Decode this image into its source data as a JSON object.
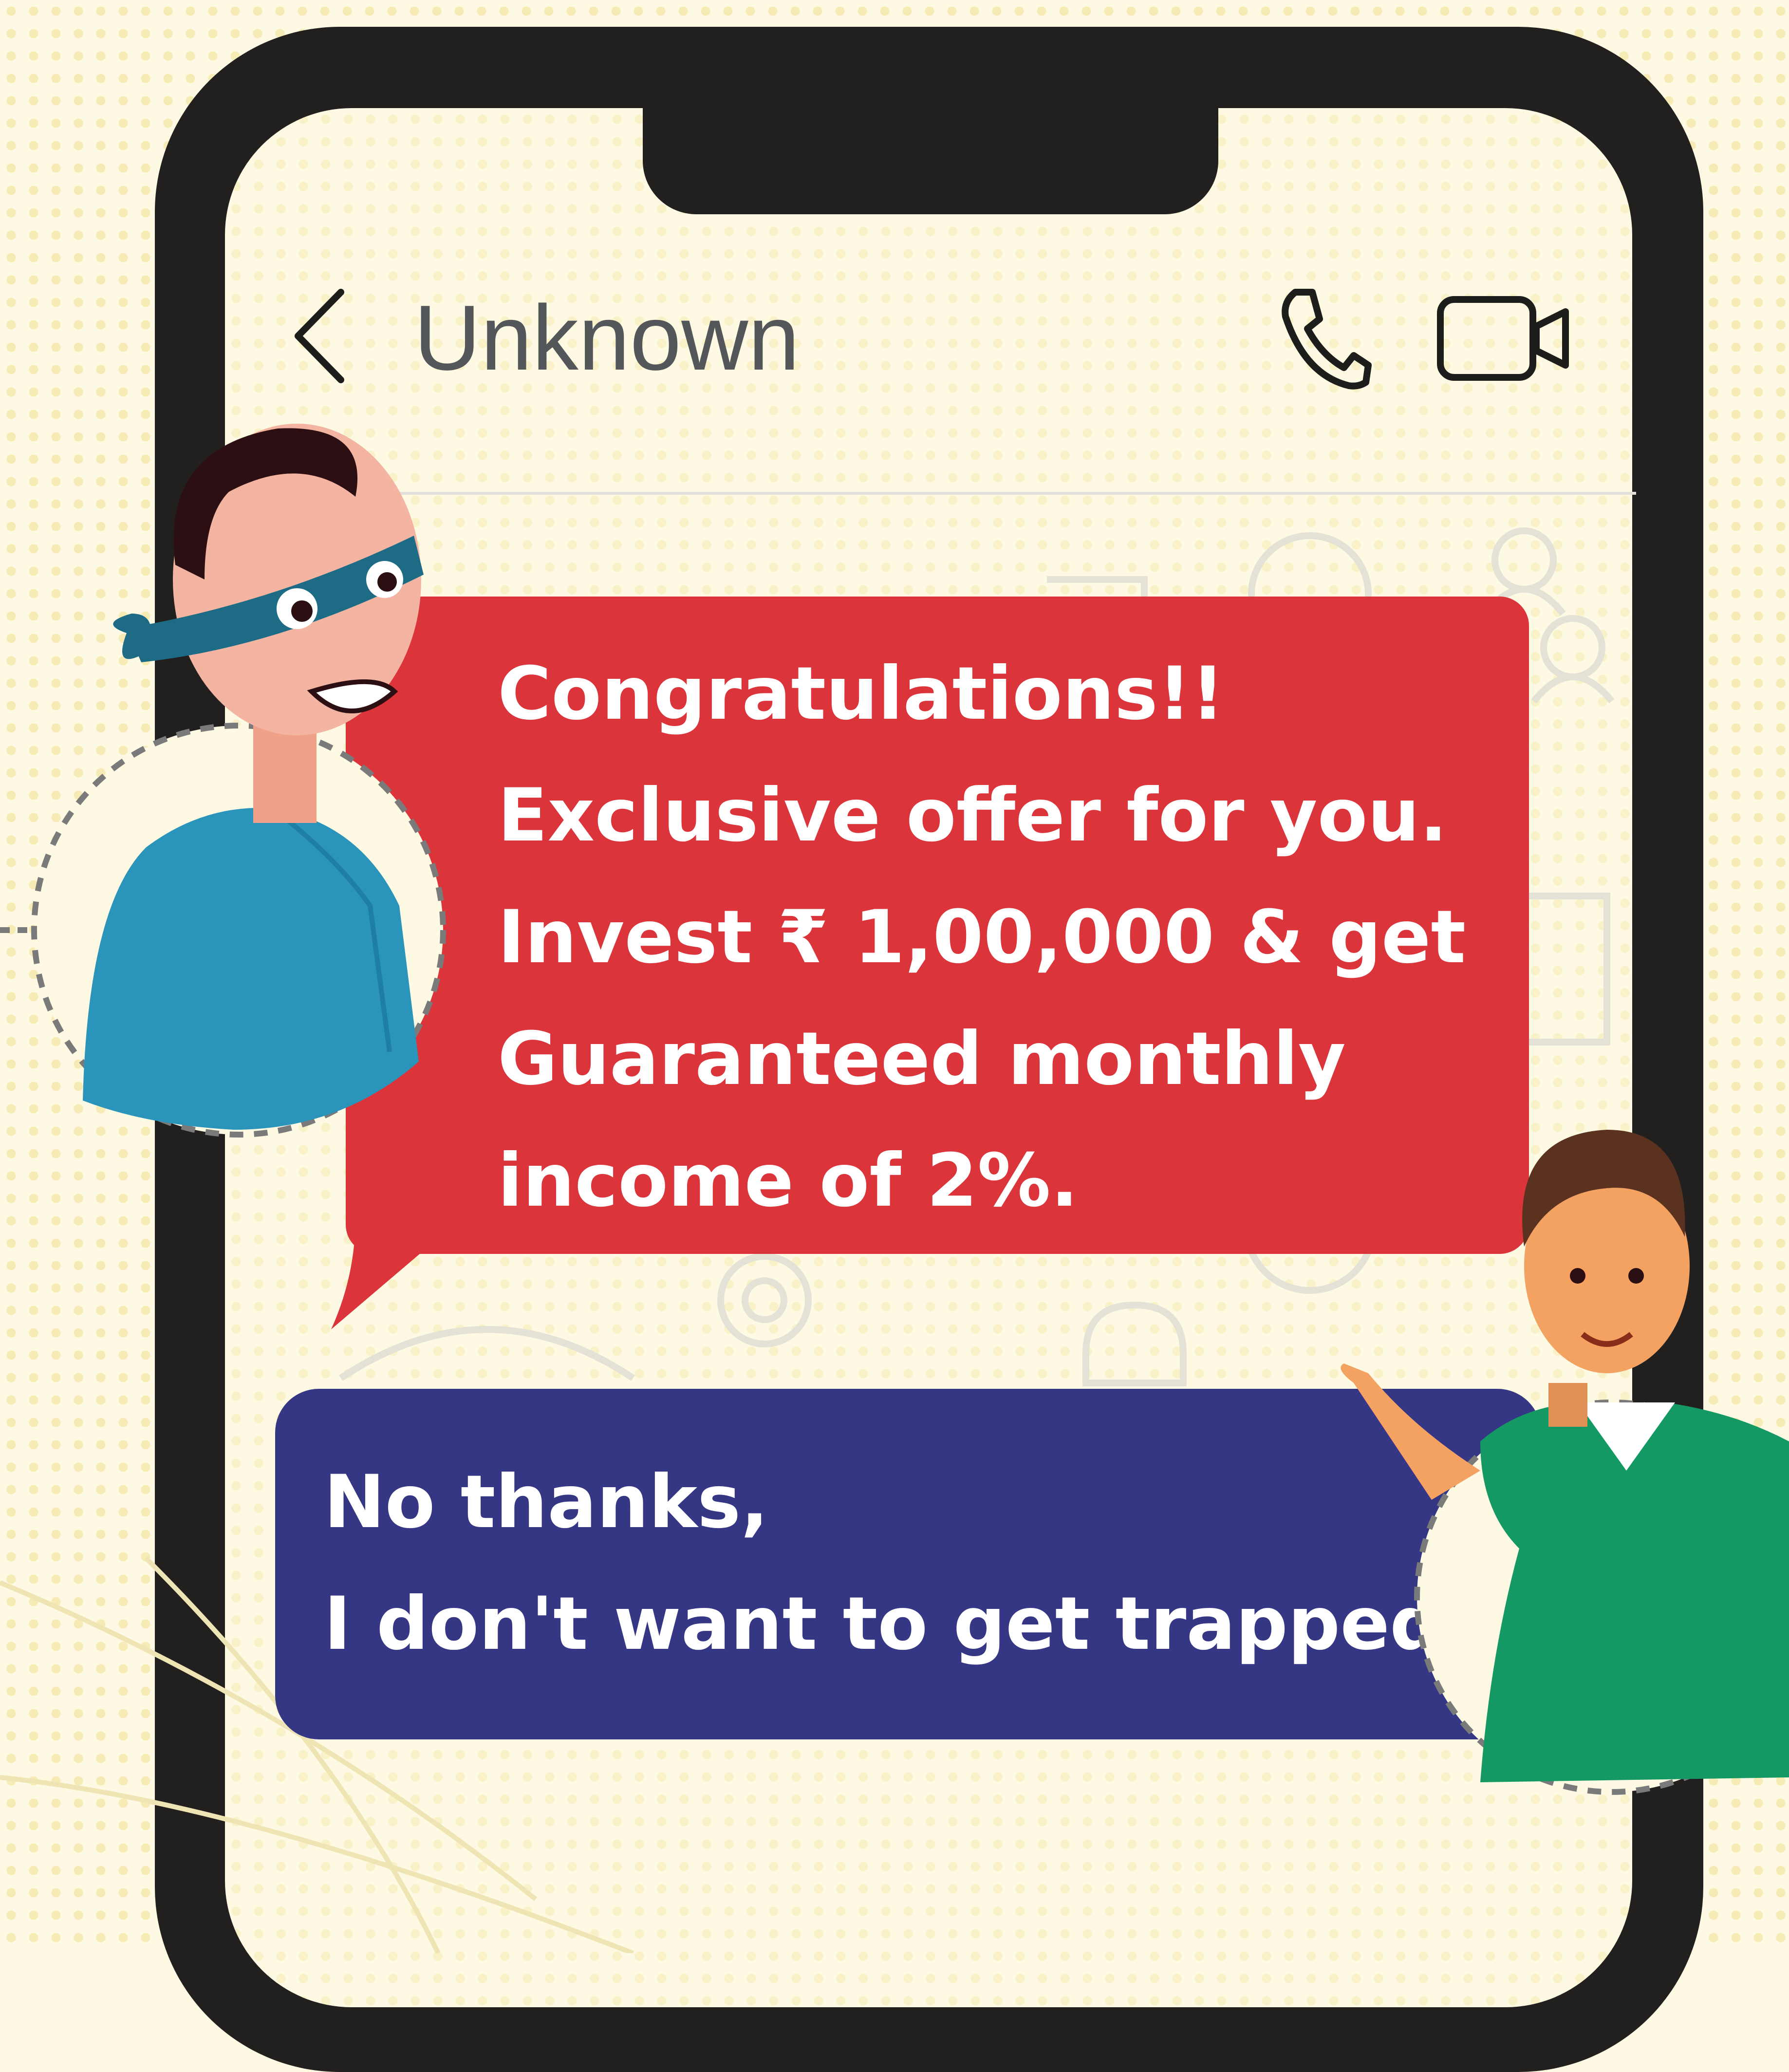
{
  "header": {
    "contact_name": "Unknown",
    "back_icon": "chevron-left-icon",
    "call_icon": "phone-icon",
    "video_icon": "video-camera-icon"
  },
  "messages": [
    {
      "sender": "scammer",
      "color": "#dc343b",
      "lines": [
        "Congratulations!!",
        "Exclusive offer for you.",
        "Invest ₹ 1,00,000 & get",
        "Guaranteed monthly",
        "income of 2%."
      ]
    },
    {
      "sender": "user",
      "color": "#353784",
      "lines": [
        "No thanks,",
        "I don't want to get trapped."
      ]
    }
  ],
  "colors": {
    "background": "#fdf9e2",
    "phone_frame": "#221f1f",
    "accent_red": "#dc343b",
    "accent_blue": "#353784",
    "user_shirt": "#159964",
    "scammer_shirt": "#2a94bb"
  }
}
